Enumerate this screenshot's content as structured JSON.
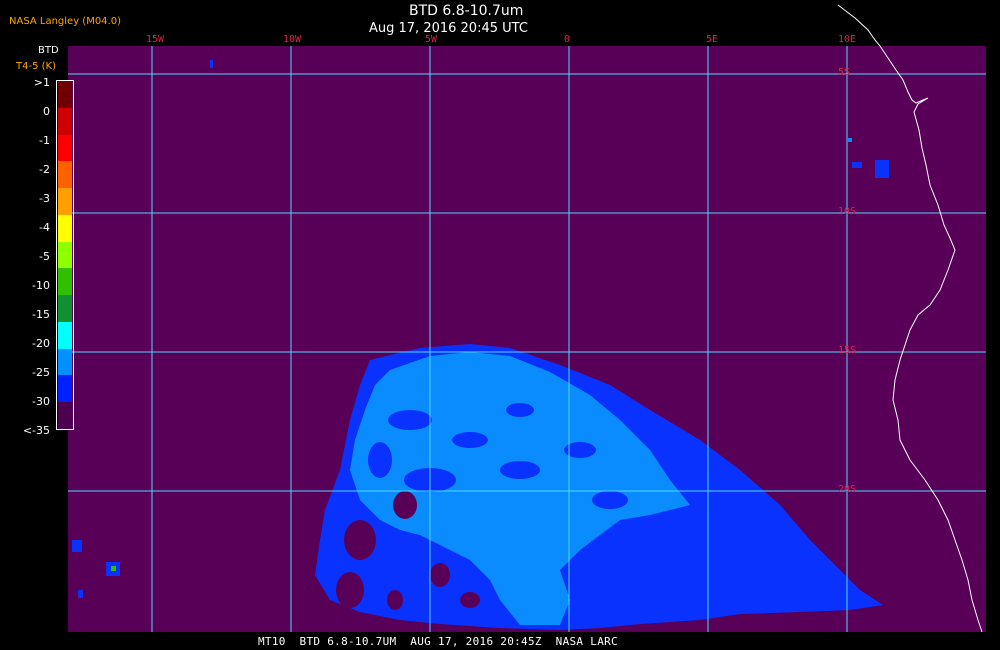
{
  "header": {
    "organization": "NASA Langley (M04.0)",
    "product_title": "BTD 6.8-10.7um",
    "datetime": "Aug 17, 2016 20:45 UTC"
  },
  "colorbar": {
    "label_top": "BTD",
    "label_sub": "T4-5 (K)",
    "ticks": [
      ">1",
      "0",
      "-1",
      "-2",
      "-3",
      "-4",
      "-5",
      "-10",
      "-15",
      "-20",
      "-25",
      "-30",
      "<-35"
    ],
    "colors": [
      "#700000",
      "#d00000",
      "#ff0000",
      "#ff6000",
      "#ffa000",
      "#ffff00",
      "#90ff00",
      "#30c000",
      "#109030",
      "#00ffff",
      "#0090ff",
      "#0020ff",
      "#4b0050"
    ]
  },
  "map": {
    "background_color": "#580058",
    "grid_color": "#4fd8ff",
    "coastline_color": "#ffffff",
    "cloud_colors": {
      "light": "#0a8cff",
      "dark": "#0a32ff"
    },
    "longitude_labels": [
      "15W",
      "10W",
      "5W",
      "0",
      "5E",
      "10E"
    ],
    "latitude_labels": [
      "5S",
      "10S",
      "15S",
      "20S"
    ]
  },
  "footer": {
    "text": "MT10  BTD 6.8-10.7UM  AUG 17, 2016 20:45Z  NASA LARC"
  }
}
